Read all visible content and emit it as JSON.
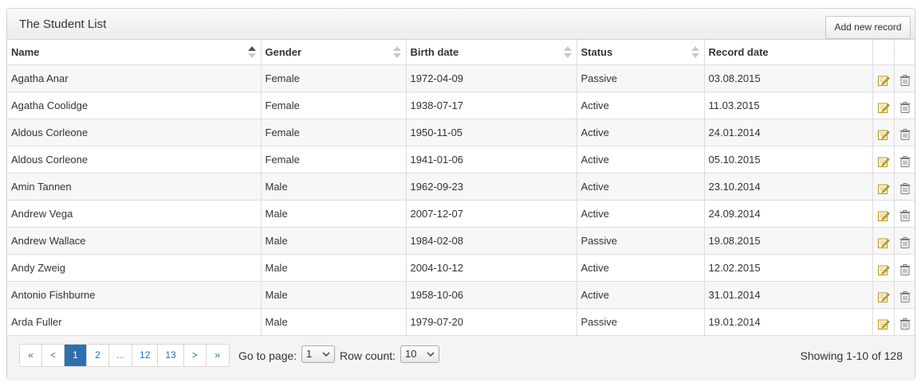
{
  "panel": {
    "title": "The Student List",
    "add_button": "Add new record"
  },
  "columns": [
    "Name",
    "Gender",
    "Birth date",
    "Status",
    "Record date"
  ],
  "rows": [
    {
      "name": "Agatha Anar",
      "gender": "Female",
      "birth": "1972-04-09",
      "status": "Passive",
      "record": "03.08.2015"
    },
    {
      "name": "Agatha Coolidge",
      "gender": "Female",
      "birth": "1938-07-17",
      "status": "Active",
      "record": "11.03.2015"
    },
    {
      "name": "Aldous Corleone",
      "gender": "Female",
      "birth": "1950-11-05",
      "status": "Active",
      "record": "24.01.2014"
    },
    {
      "name": "Aldous Corleone",
      "gender": "Female",
      "birth": "1941-01-06",
      "status": "Active",
      "record": "05.10.2015"
    },
    {
      "name": "Amin Tannen",
      "gender": "Male",
      "birth": "1962-09-23",
      "status": "Active",
      "record": "23.10.2014"
    },
    {
      "name": "Andrew Vega",
      "gender": "Male",
      "birth": "2007-12-07",
      "status": "Active",
      "record": "24.09.2014"
    },
    {
      "name": "Andrew Wallace",
      "gender": "Male",
      "birth": "1984-02-08",
      "status": "Passive",
      "record": "19.08.2015"
    },
    {
      "name": "Andy Zweig",
      "gender": "Male",
      "birth": "2004-10-12",
      "status": "Active",
      "record": "12.02.2015"
    },
    {
      "name": "Antonio Fishburne",
      "gender": "Male",
      "birth": "1958-10-06",
      "status": "Active",
      "record": "31.01.2014"
    },
    {
      "name": "Arda Fuller",
      "gender": "Male",
      "birth": "1979-07-20",
      "status": "Passive",
      "record": "19.01.2014"
    }
  ],
  "row_icons": {
    "edit": "edit-icon",
    "delete": "trash-icon"
  },
  "pagination": {
    "buttons": [
      "«",
      "<",
      "1",
      "2",
      "...",
      "12",
      "13",
      ">",
      "»"
    ],
    "active_page": "1",
    "goto_label": "Go to page:",
    "goto_value": "1",
    "rowcount_label": "Row count:",
    "rowcount_value": "10",
    "showing": "Showing 1-10 of 128"
  },
  "colors": {
    "accent": "#2f6fb0",
    "link": "#2a6fb0",
    "edit_icon": "#e0b93a"
  }
}
